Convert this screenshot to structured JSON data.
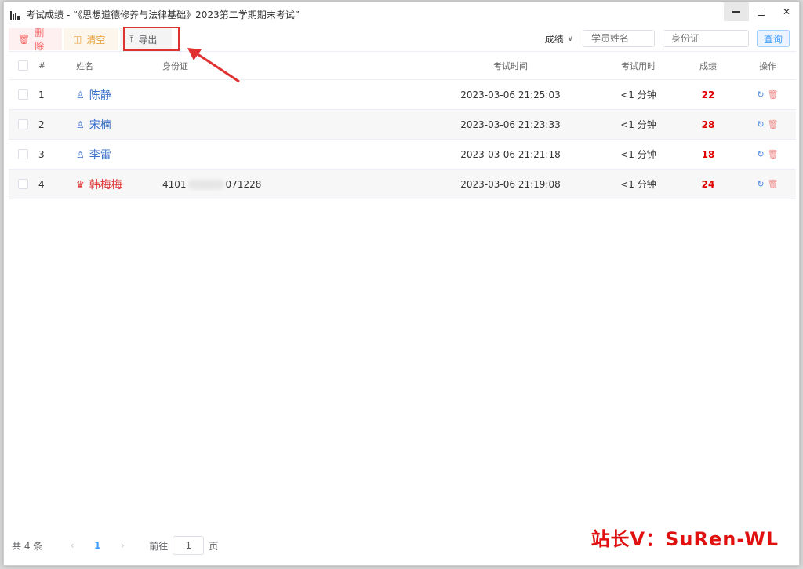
{
  "window": {
    "title": "考试成绩 - “《思想道德修养与法律基础》2023第二学期期末考试”",
    "controls": {
      "minimize_icon": "minimize-icon",
      "maximize_icon": "maximize-icon",
      "close_icon": "close-icon",
      "close_glyph": "✕"
    }
  },
  "toolbar": {
    "delete_label": "删除",
    "clear_label": "清空",
    "export_label": "导出",
    "delete_icon": "trash-icon",
    "clear_icon": "box-icon",
    "export_icon": "upload-tray-icon"
  },
  "filters": {
    "sort_value": "成绩",
    "student_name_placeholder": "学员姓名",
    "id_card_placeholder": "身份证",
    "query_label": "查询"
  },
  "table": {
    "headers": {
      "index": "#",
      "name": "姓名",
      "id_card": "身份证",
      "exam_time": "考试时间",
      "duration": "考试用时",
      "score": "成绩",
      "actions": "操作"
    },
    "rows": [
      {
        "index": "1",
        "name": "陈静",
        "gender": "male",
        "id_card": "",
        "exam_time": "2023-03-06 21:25:03",
        "duration": "<1 分钟",
        "score": "22"
      },
      {
        "index": "2",
        "name": "宋楠",
        "gender": "male",
        "id_card": "",
        "exam_time": "2023-03-06 21:23:33",
        "duration": "<1 分钟",
        "score": "28"
      },
      {
        "index": "3",
        "name": "李雷",
        "gender": "male",
        "id_card": "",
        "exam_time": "2023-03-06 21:21:18",
        "duration": "<1 分钟",
        "score": "18"
      },
      {
        "index": "4",
        "name": "韩梅梅",
        "gender": "female",
        "id_card_start": "4101",
        "id_card_end": "071228",
        "exam_time": "2023-03-06 21:19:08",
        "duration": "<1 分钟",
        "score": "24"
      }
    ]
  },
  "pagination": {
    "total": "共 4 条",
    "prev": "‹",
    "current": "1",
    "next": "›",
    "goto_label": "前往",
    "goto_value": "1",
    "page_suffix": "页"
  },
  "watermark": "站长V：SuRen-WL",
  "colors": {
    "score_red": "#e00000",
    "male_blue": "#3a6fc9",
    "female_red": "#e03c3c",
    "highlight_red": "#e03131",
    "primary_blue": "#409eff"
  }
}
